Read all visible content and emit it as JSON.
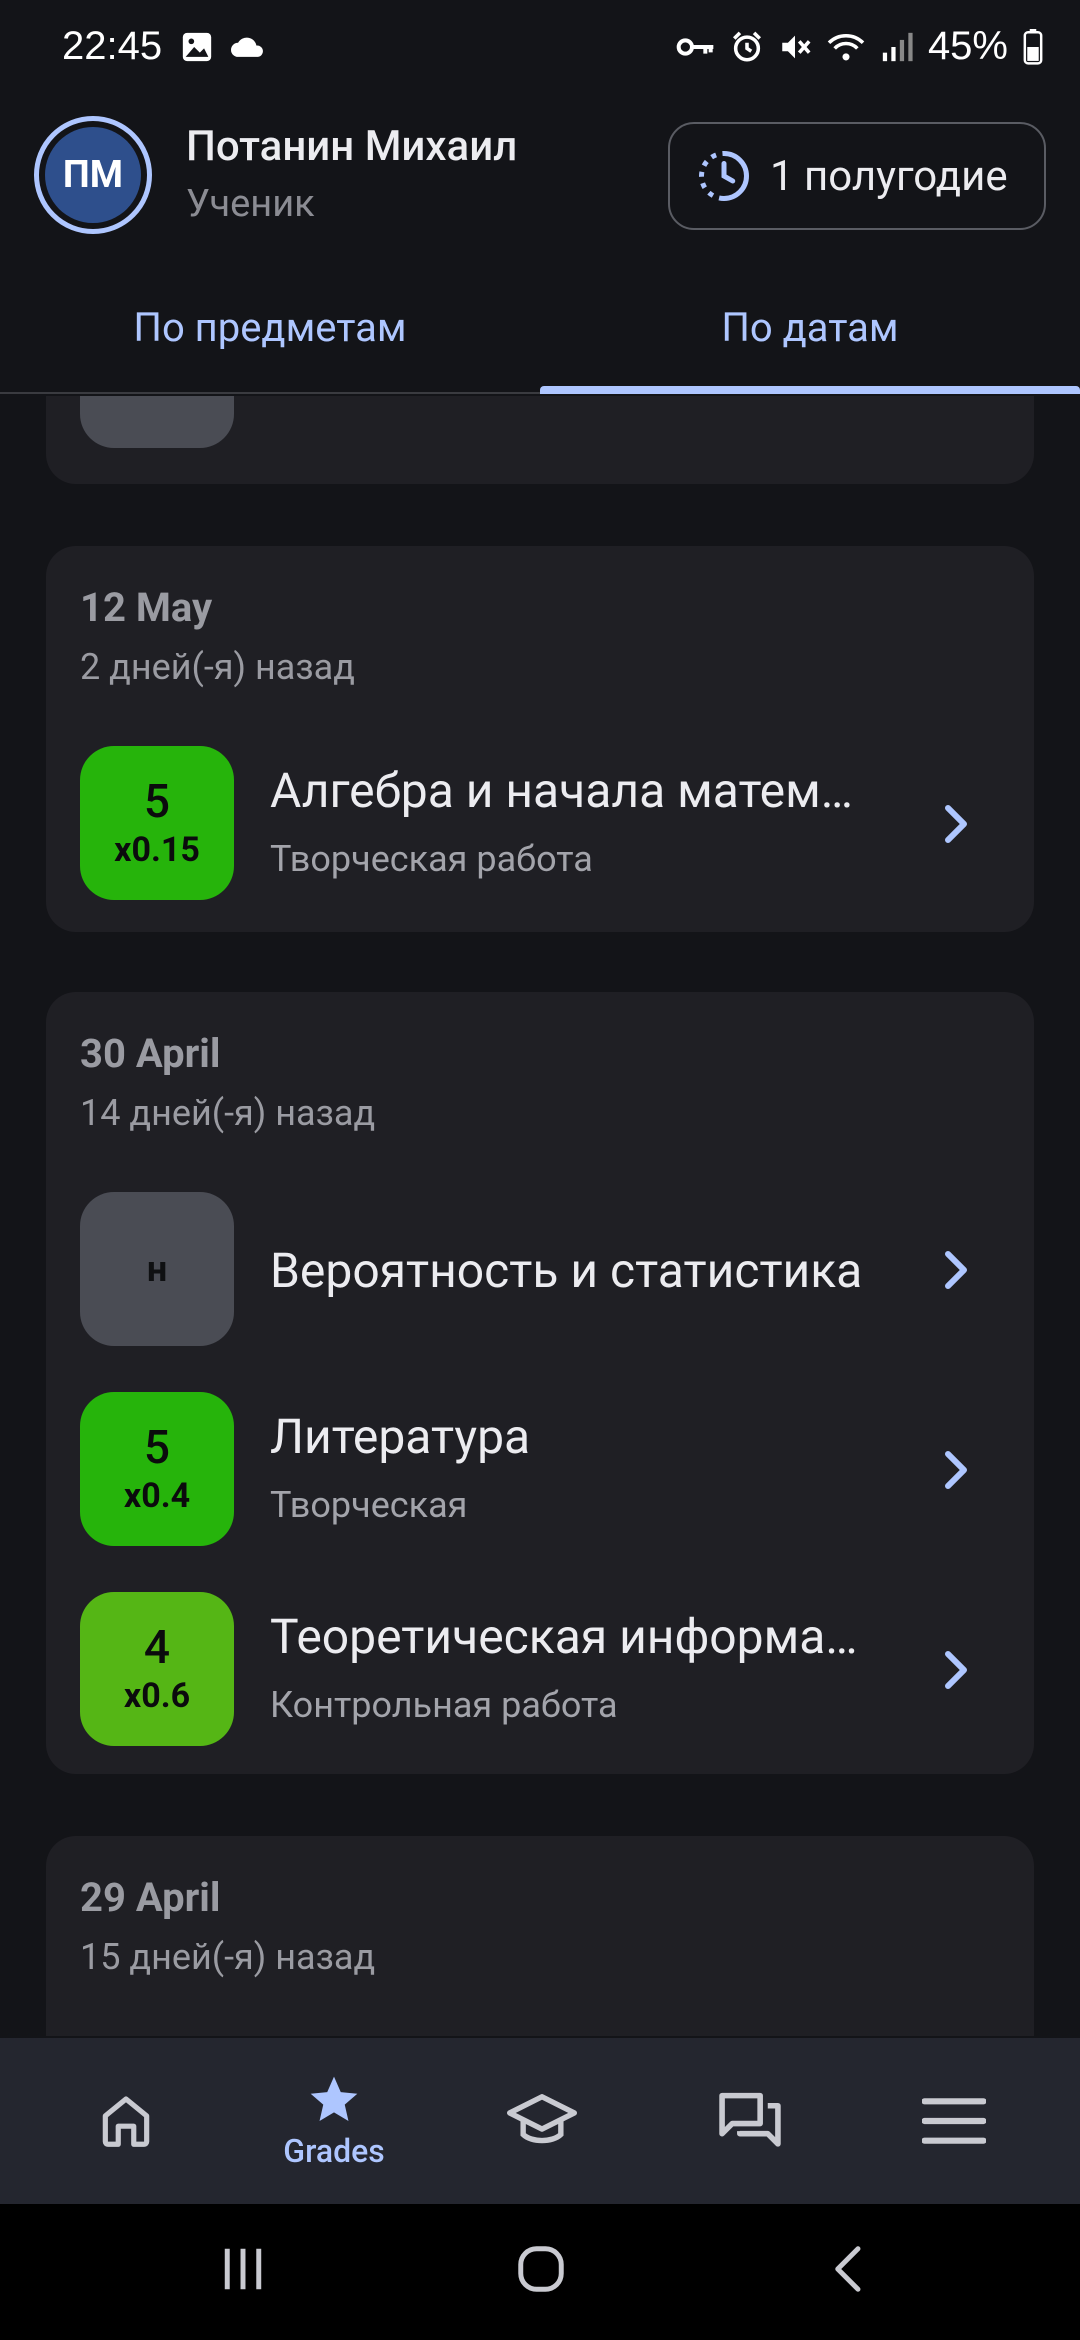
{
  "status_bar": {
    "time": "22:45",
    "battery_percent": "45%",
    "left_icons": [
      "image-icon",
      "cloud-icon"
    ],
    "right_icons": [
      "key-icon",
      "alarm-icon",
      "mute-icon",
      "wifi-icon",
      "signal-icon",
      "battery-icon"
    ]
  },
  "header": {
    "avatar_initials": "ПМ",
    "user_name": "Потанин Михаил",
    "user_role": "Ученик",
    "period_label": "1 полугодие"
  },
  "tabs": [
    {
      "label": "По предметам",
      "active": false
    },
    {
      "label": "По датам",
      "active": true
    }
  ],
  "days": [
    {
      "date": "12 May",
      "ago": "2 дней(-я) назад",
      "grades": [
        {
          "value": "5",
          "weight": "x0.15",
          "subject": "Алгебра и начала матем…",
          "work": "Творческая работа"
        }
      ]
    },
    {
      "date": "30 April",
      "ago": "14 дней(-я) назад",
      "grades": [
        {
          "value": "н",
          "weight": "",
          "subject": "Вероятность и статистика",
          "work": ""
        },
        {
          "value": "5",
          "weight": "x0.4",
          "subject": "Литература",
          "work": "Творческая"
        },
        {
          "value": "4",
          "weight": "x0.6",
          "subject": "Теоретическая информа…",
          "work": "Контрольная работа"
        }
      ]
    },
    {
      "date": "29 April",
      "ago": "15 дней(-я) назад",
      "grades": []
    }
  ],
  "colors": {
    "accent": "#aec6ff",
    "grade_5": "#26b40b",
    "grade_4": "#55b615",
    "absence": "#4a4c54",
    "card_bg": "#1f1f24",
    "page_bg": "#131418"
  },
  "bottom_nav": [
    {
      "icon": "home-icon",
      "label": ""
    },
    {
      "icon": "star-icon",
      "label": "Grades",
      "active": true
    },
    {
      "icon": "graduation-cap-icon",
      "label": ""
    },
    {
      "icon": "chat-icon",
      "label": ""
    },
    {
      "icon": "menu-icon",
      "label": ""
    }
  ]
}
